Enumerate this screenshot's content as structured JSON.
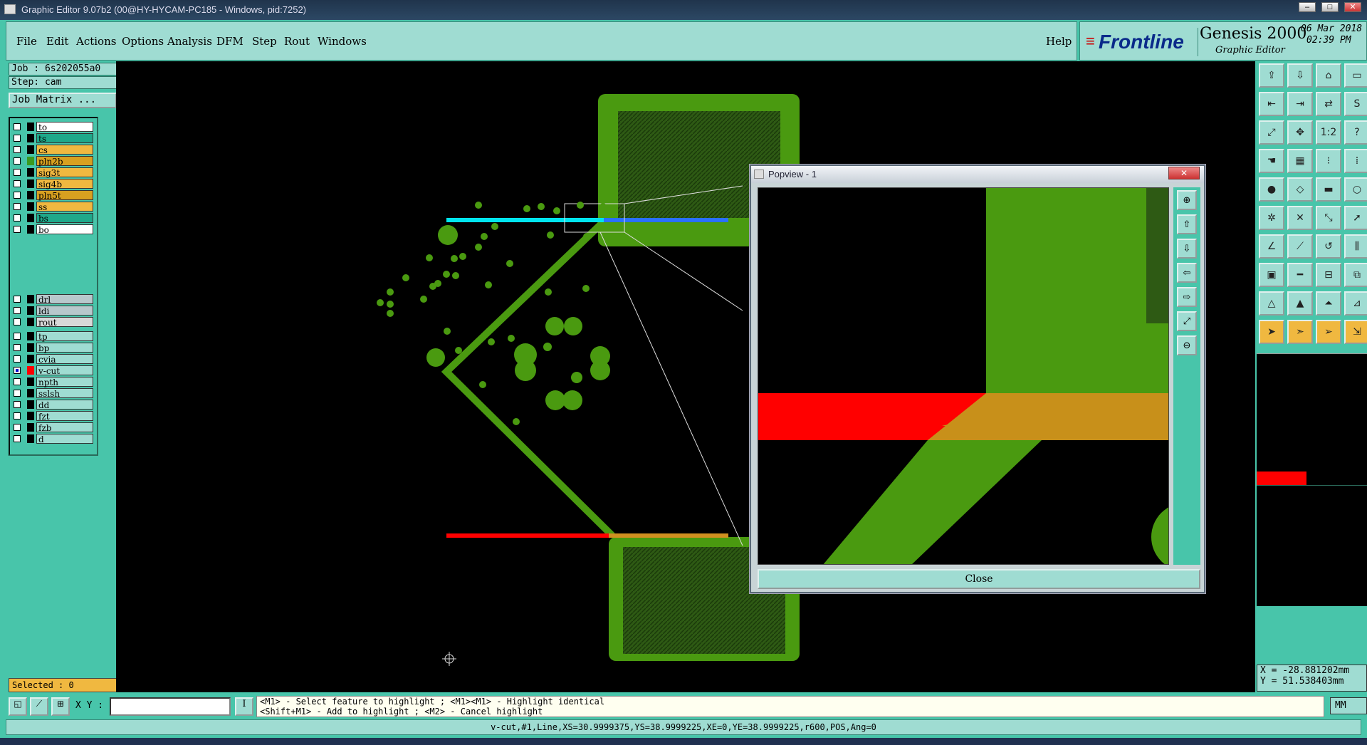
{
  "window": {
    "title": "Graphic Editor 9.07b2 (00@HY-HYCAM-PC185 - Windows, pid:7252)"
  },
  "menu": {
    "items": [
      "File",
      "Edit",
      "Actions",
      "Options",
      "Analysis",
      "DFM",
      "Step",
      "Rout",
      "Windows"
    ],
    "help": "Help"
  },
  "brand": {
    "logo": "Frontline",
    "product": "Genesis 2000",
    "subtitle": "Graphic Editor",
    "date": "06 Mar 2018",
    "time": "02:39 PM"
  },
  "job": {
    "job_label": "Job : 6s202055a0",
    "step_label": "Step: cam",
    "matrix_button": "Job Matrix ..."
  },
  "layers": {
    "group1": [
      {
        "name": "to",
        "color": "#ffffff"
      },
      {
        "name": "ts",
        "color": "#1fa88a"
      },
      {
        "name": "cs",
        "color": "#f0b840"
      },
      {
        "name": "pln2b",
        "color": "#d8a020",
        "active_swatch": "#3a9a20"
      },
      {
        "name": "sig3t",
        "color": "#f0b840"
      },
      {
        "name": "sig4b",
        "color": "#f0b840"
      },
      {
        "name": "pln5t",
        "color": "#d8a020"
      },
      {
        "name": "ss",
        "color": "#f0b840"
      },
      {
        "name": "bs",
        "color": "#1fa88a"
      },
      {
        "name": "bo",
        "color": "#ffffff"
      }
    ],
    "group2": [
      {
        "name": "drl",
        "color": "#b8c8cc"
      },
      {
        "name": "ldi",
        "color": "#b8c8cc"
      },
      {
        "name": "rout",
        "color": "#d8d8d8"
      }
    ],
    "group3": [
      {
        "name": "tp",
        "color": "#9fdcd2"
      },
      {
        "name": "bp",
        "color": "#9fdcd2"
      },
      {
        "name": "cvia",
        "color": "#9fdcd2"
      },
      {
        "name": "v-cut",
        "color": "#9fdcd2",
        "active_swatch": "#ff0000",
        "checked_color": "#0000cc"
      },
      {
        "name": "npth",
        "color": "#9fdcd2"
      },
      {
        "name": "sslsh",
        "color": "#9fdcd2"
      },
      {
        "name": "dd",
        "color": "#9fdcd2"
      },
      {
        "name": "fzt",
        "color": "#9fdcd2"
      },
      {
        "name": "fzb",
        "color": "#9fdcd2"
      },
      {
        "name": "d",
        "color": "#9fdcd2"
      }
    ]
  },
  "selected": "Selected : 0",
  "coords": {
    "x": "X = -28.881202mm",
    "y": "Y = 51.538403mm",
    "units": "MM"
  },
  "cmd": {
    "xy_label": "X Y :",
    "xy_value": "",
    "hint1": "<M1> - Select feature to highlight ; <M1><M1> - Highlight identical",
    "hint2": "<Shift+M1> - Add to highlight ; <M2> - Cancel highlight"
  },
  "status": "v-cut,#1,Line,XS=30.9999375,YS=38.9999225,XE=0,YE=38.9999225,r600,POS,Ang=0",
  "popview": {
    "title": "Popview - 1",
    "close": "Close"
  },
  "colors": {
    "panel": "#48c5aa",
    "light": "#9fdcd2",
    "green_feature": "#4a9a10",
    "vcut": "#ff0000",
    "cyan_line": "#00e5ee"
  }
}
